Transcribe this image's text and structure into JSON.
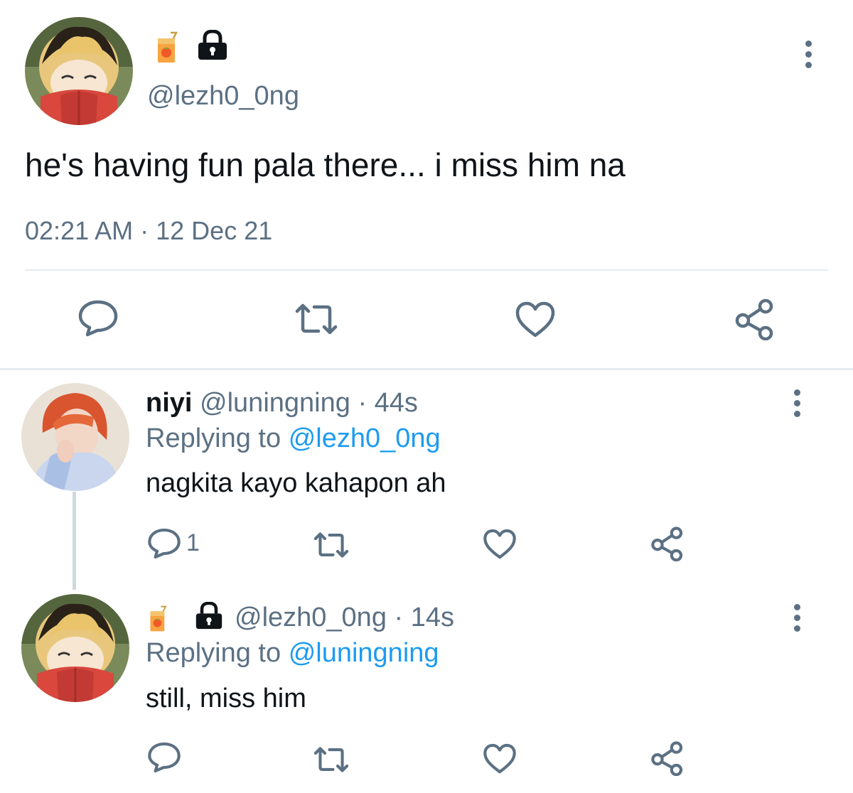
{
  "main_tweet": {
    "emoji_icon": "juice-box-icon",
    "lock_icon": "lock-icon",
    "handle": "@lezh0_0ng",
    "text": "he's having fun pala there... i miss him na",
    "time": "02:21 AM",
    "separator": "·",
    "date": "12 Dec 21"
  },
  "replies": [
    {
      "display_name": "niyi",
      "handle": "@luningning",
      "meta": "· 44s",
      "replying_prefix": "Replying to",
      "replying_to": "@lezh0_0ng",
      "text": "nagkita kayo kahapon ah",
      "reply_count": "1"
    },
    {
      "handle": "@lezh0_0ng",
      "meta": "· 14s",
      "replying_prefix": "Replying to",
      "replying_to": "@luningning",
      "text": "still, miss him"
    }
  ],
  "colors": {
    "text": "#0f1419",
    "secondary": "#5b7083",
    "link": "#1d9bf0",
    "divider": "#e6ecf0"
  }
}
